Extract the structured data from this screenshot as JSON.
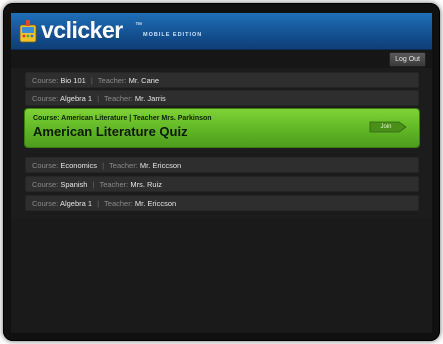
{
  "app": {
    "name": "vclicker",
    "tm": "™",
    "edition": "MOBILE EDITION"
  },
  "toolbar": {
    "logout_label": "Log Out"
  },
  "labels": {
    "course": "Course:",
    "teacher": "Teacher:",
    "separator": "|"
  },
  "courses": [
    {
      "course": "Bio 101",
      "teacher": "Mr. Cane"
    },
    {
      "course": "Algebra 1",
      "teacher": "Mr. Jarris"
    },
    {
      "course": "Economics",
      "teacher": "Mr. Ericcson"
    },
    {
      "course": "Spanish",
      "teacher": "Mrs. Ruiz"
    },
    {
      "course": "Algebra 1",
      "teacher": "Mr. Ericcson"
    }
  ],
  "active_session": {
    "subtitle": "Course: American Literature | Teacher Mrs. Parkinson",
    "title": "American Literature Quiz",
    "join_label": "Join"
  },
  "colors": {
    "header_blue": "#1f6fb8",
    "active_green": "#6cc22c",
    "row_bg": "#2e2e2e"
  }
}
